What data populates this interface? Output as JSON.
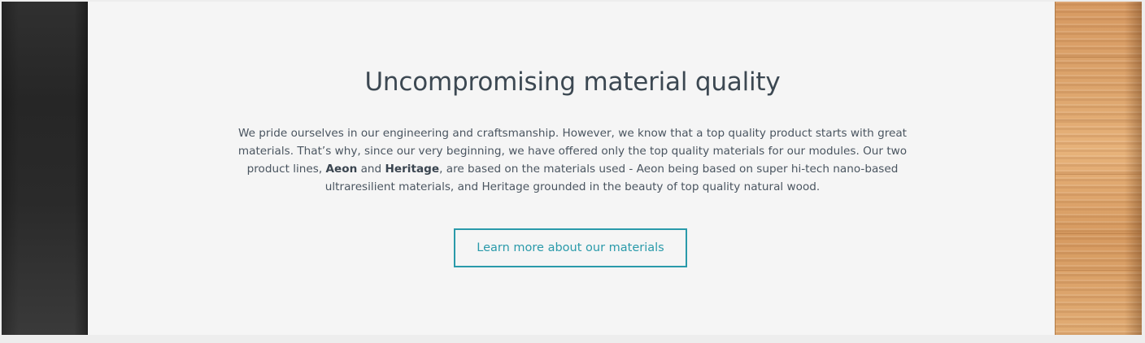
{
  "section": {
    "title": "Uncompromising material quality",
    "paragraph": {
      "part1": "We pride ourselves in our engineering and craftsmanship. However, we know that a top quality product starts with great materials. That’s why, since our very beginning, we have offered only the top quality materials for our modules. Our two product lines, ",
      "aeon": "Aeon",
      "part2": " and ",
      "heritage": "Heritage",
      "part3": ", are based on the materials used - Aeon being based on super hi-tech nano-based ultraresilient materials, and Heritage grounded in the beauty of top quality natural wood."
    },
    "cta_label": "Learn more about our materials"
  },
  "images": {
    "left": "dark-material-sample",
    "right": "natural-wood-sample"
  },
  "colors": {
    "background": "#f5f5f5",
    "title": "#3c4852",
    "text": "#4a5560",
    "accent": "#2a9aaa"
  }
}
